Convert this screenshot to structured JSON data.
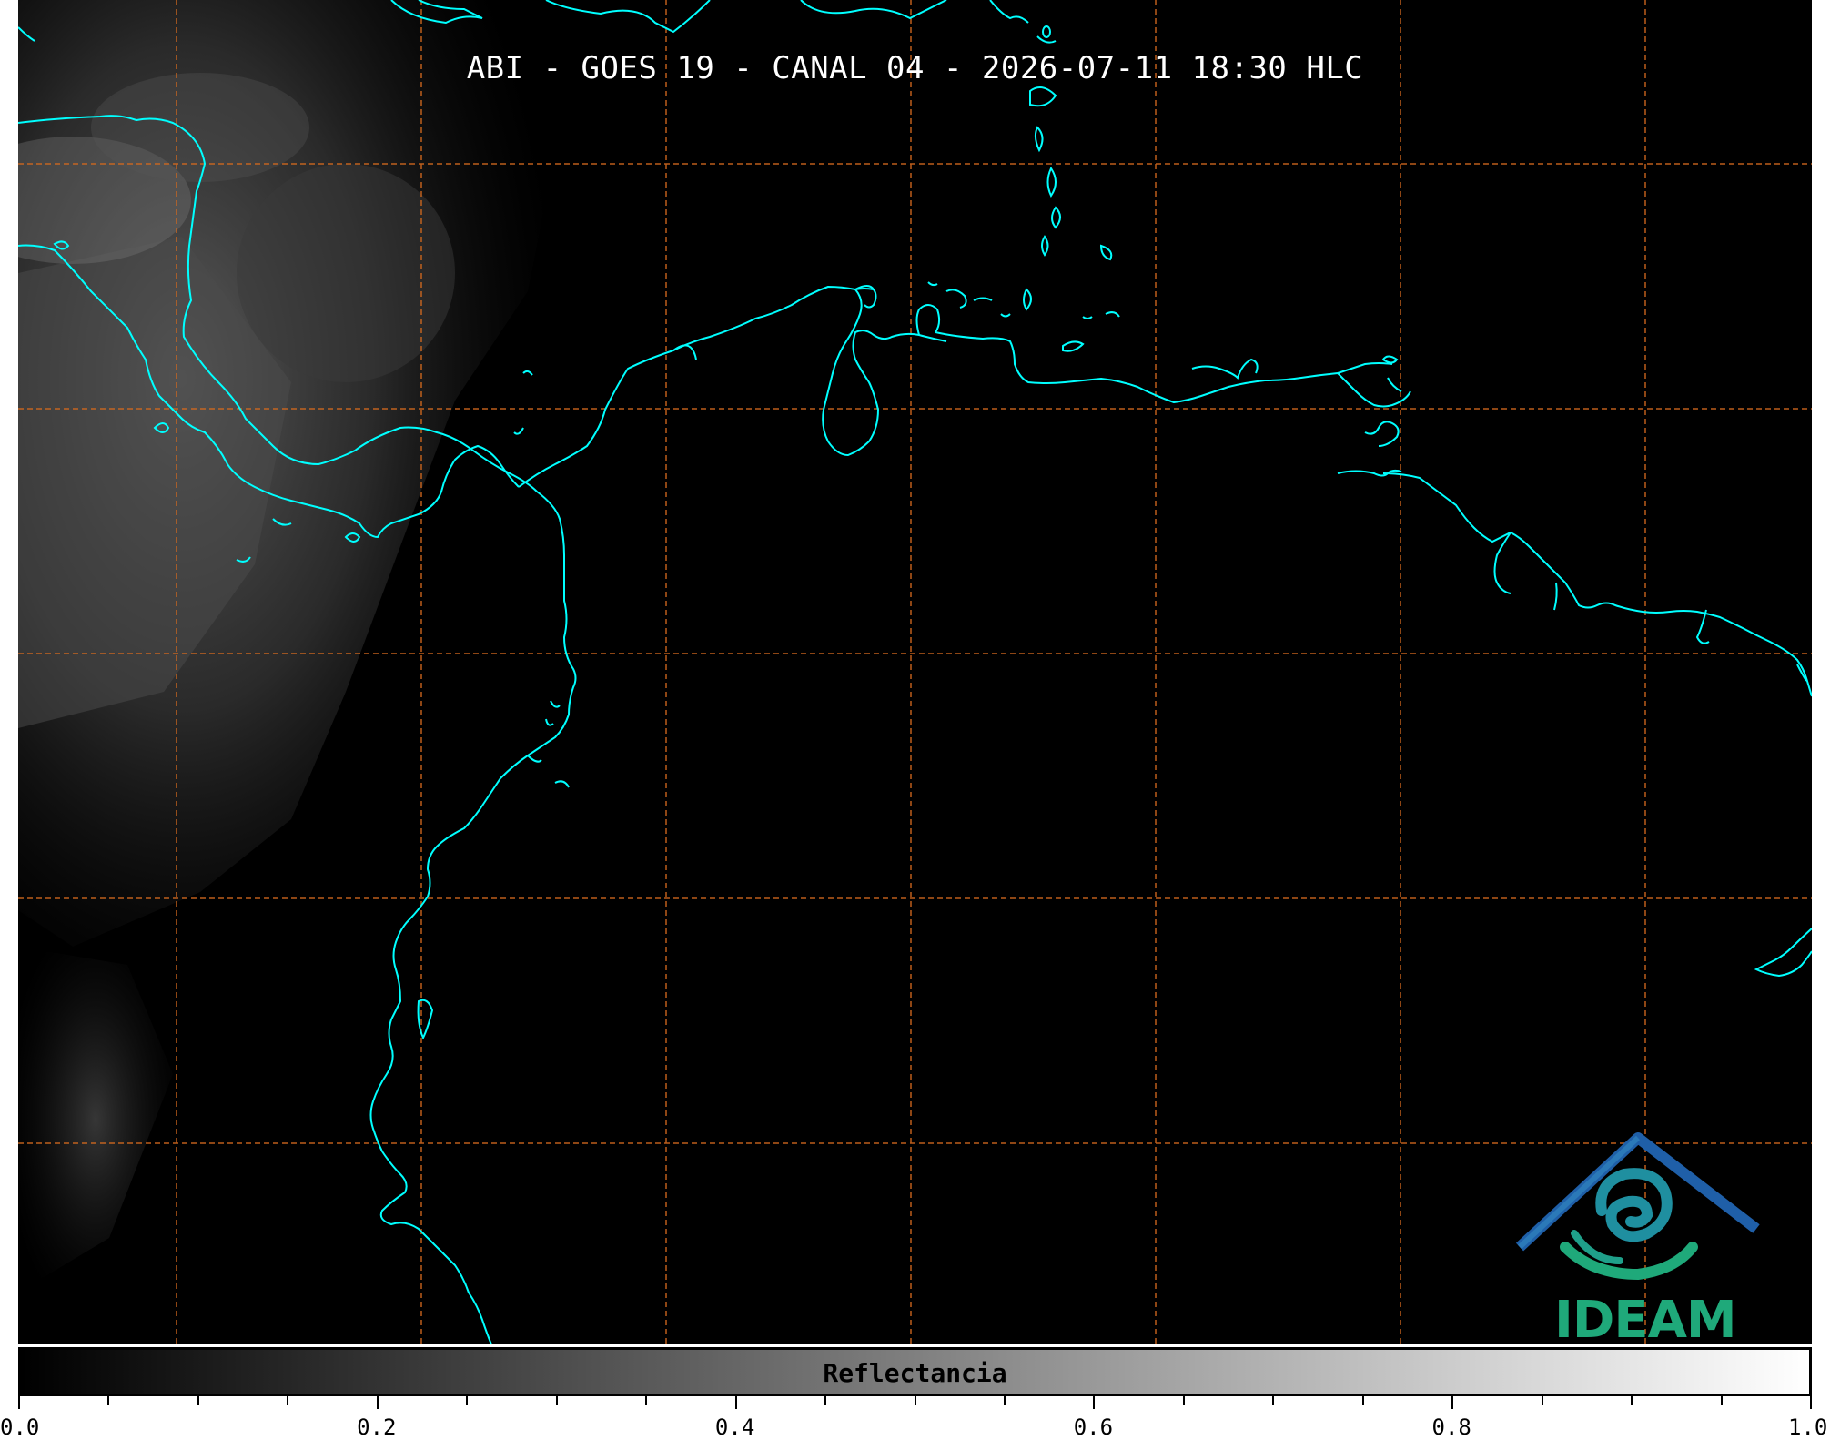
{
  "map": {
    "title": "ABI - GOES 19 - CANAL 04 - 2026-07-11 18:30 HLC",
    "coastline_color": "#00ffff",
    "grid_color": "#d2691e",
    "background_color": "#000000",
    "logo": {
      "name": "ideam-logo",
      "text": "IDEAM",
      "colors": [
        "#1f5fa8",
        "#1fa97a"
      ]
    }
  },
  "colorbar": {
    "label": "Reflectancia",
    "min": 0.0,
    "max": 1.0,
    "tick_labels": [
      "0.0",
      "0.2",
      "0.4",
      "0.6",
      "0.8",
      "1.0"
    ],
    "gradient": [
      "#000000",
      "#ffffff"
    ]
  }
}
